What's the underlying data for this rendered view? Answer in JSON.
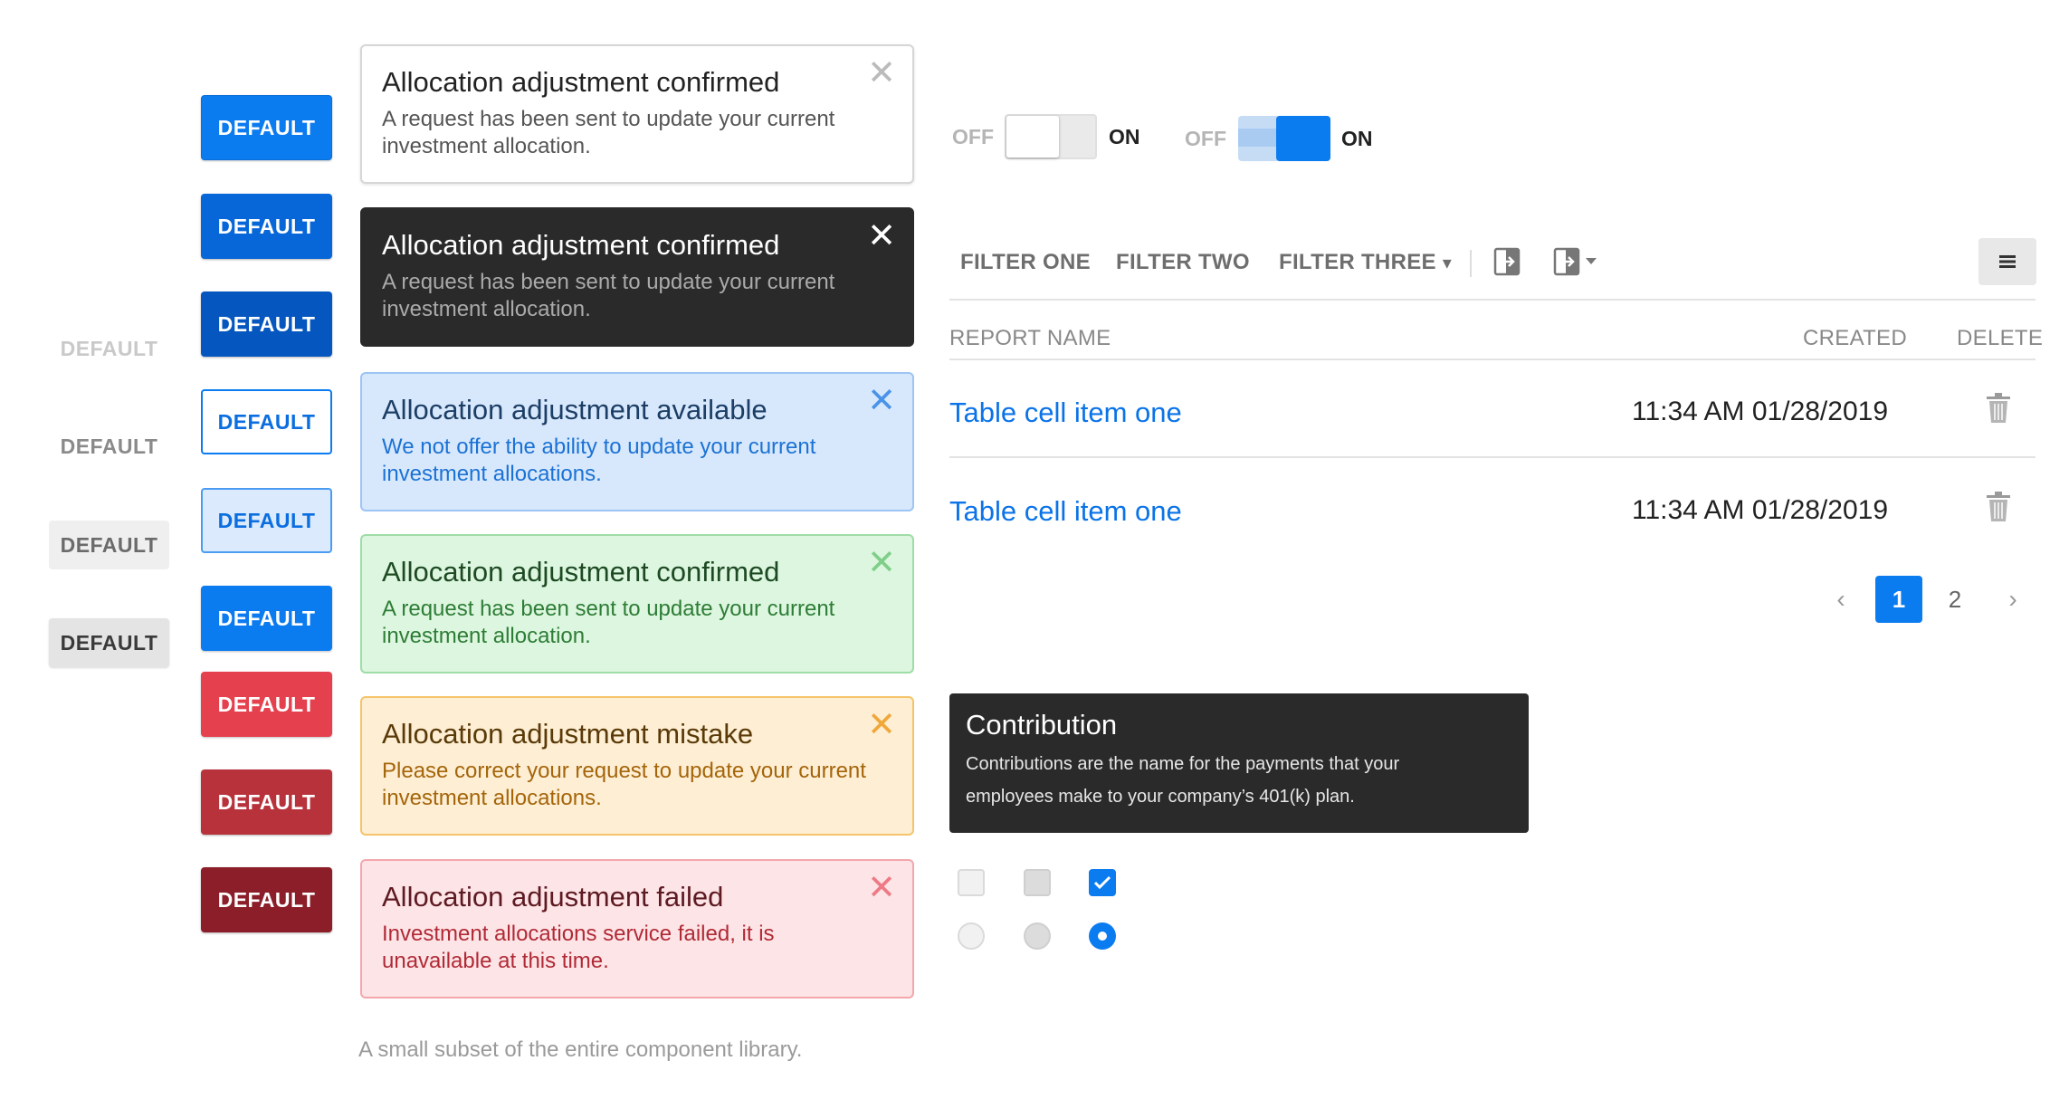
{
  "buttons": {
    "primary": [
      "DEFAULT",
      "DEFAULT",
      "DEFAULT",
      "DEFAULT",
      "DEFAULT",
      "DEFAULT",
      "DEFAULT",
      "DEFAULT",
      "DEFAULT"
    ],
    "secondary": [
      "DEFAULT",
      "DEFAULT",
      "DEFAULT",
      "DEFAULT"
    ]
  },
  "alerts": [
    {
      "variant": "default",
      "title": "Allocation adjustment confirmed",
      "body": "A request has been sent to update your current investment allocation.",
      "close": "✕"
    },
    {
      "variant": "dark",
      "title": "Allocation adjustment confirmed",
      "body": "A request has been sent to update your current investment allocation.",
      "close": "✕"
    },
    {
      "variant": "info",
      "title": "Allocation adjustment available",
      "body": "We not offer the ability to update your current investment allocations.",
      "close": "✕"
    },
    {
      "variant": "success",
      "title": "Allocation adjustment confirmed",
      "body": "A request has been sent to update your current investment allocation.",
      "close": "✕"
    },
    {
      "variant": "warning",
      "title": "Allocation adjustment mistake",
      "body": "Please correct your request to update your current investment allocations.",
      "close": "✕"
    },
    {
      "variant": "error",
      "title": "Allocation adjustment failed",
      "body": "Investment allocations service failed, it is unavailable at this time.",
      "close": "✕"
    }
  ],
  "caption": "A small subset of the entire component library.",
  "toggles": [
    {
      "off_label": "OFF",
      "on_label": "ON",
      "state": "off"
    },
    {
      "off_label": "OFF",
      "on_label": "ON",
      "state": "on"
    }
  ],
  "filters": {
    "items": [
      "FILTER ONE",
      "FILTER TWO",
      "FILTER THREE"
    ],
    "dropdown_caret": "▾",
    "icons": [
      "export-icon",
      "export-dropdown-icon",
      "menu-icon"
    ]
  },
  "table": {
    "headers": {
      "name": "REPORT NAME",
      "created": "CREATED",
      "delete": "DELETE"
    },
    "rows": [
      {
        "name": "Table cell item one",
        "created": "11:34 AM 01/28/2019",
        "delete_icon": "trash-icon"
      },
      {
        "name": "Table cell item one",
        "created": "11:34 AM 01/28/2019",
        "delete_icon": "trash-icon"
      }
    ]
  },
  "pagination": {
    "prev": "‹",
    "pages": [
      "1",
      "2"
    ],
    "current": "1",
    "next": "›"
  },
  "tooltip": {
    "title": "Contribution",
    "body_line1": "Contributions are the name for the payments that your",
    "body_line2": "employees make to your company’s 401(k) plan."
  },
  "controls": {
    "checkboxes": [
      "unchecked",
      "disabled",
      "checked"
    ],
    "radios": [
      "unselected",
      "disabled",
      "selected"
    ]
  },
  "colors": {
    "primary": "#0b7bf0",
    "danger": "#e5404e",
    "dark": "#2a2a2a"
  }
}
